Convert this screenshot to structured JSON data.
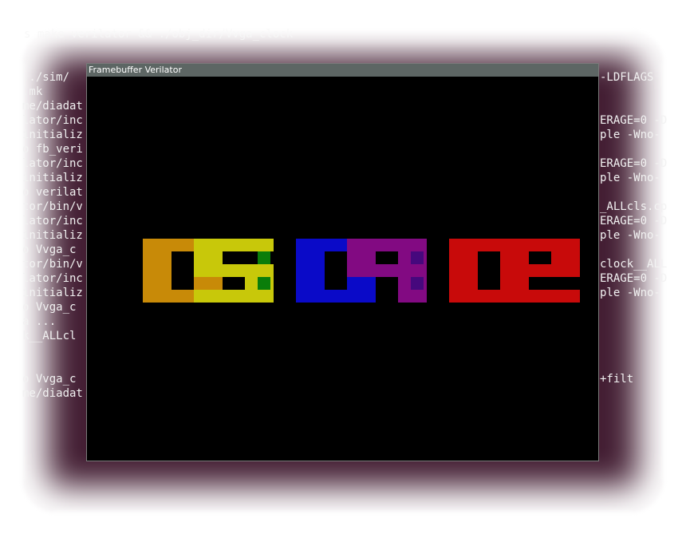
{
  "terminal": {
    "prompt_command": "s make verilator && ./obj_dir/Vvga_clock",
    "left_lines": [
      "../sim/",
      ".mk",
      "me/diadat",
      "lator/inc",
      "initializ",
      "o fb_veri",
      "lator/inc",
      "initializ",
      "o verilat",
      "tor/bin/v",
      "lator/inc",
      "initializ",
      "o Vvga_c",
      "tor/bin/v",
      "lator/inc",
      "initializ",
      "o Vvga_c",
      "a ...",
      "k__ALLcl",
      "",
      "",
      "o Vvga_c",
      "me/diadat"
    ],
    "right_lines": [
      "-LDFLAGS",
      "",
      "",
      "ERAGE=0 -D",
      "ple -Wno-",
      "",
      "ERAGE=0 -D",
      "ple -Wno-",
      "",
      "_ALLcls.cp",
      "ERAGE=0 -D",
      "ple -Wno-",
      "",
      "clock__ALL",
      "ERAGE=0 -D",
      "ple -Wno-",
      "",
      "",
      "",
      "",
      "",
      "+filt",
      ""
    ]
  },
  "window": {
    "title": "Framebuffer Verilator"
  },
  "clock": {
    "time_text": "05:09:02",
    "digits": [
      {
        "char": "0",
        "color": "#c88a08"
      },
      {
        "char": "5",
        "color": "#c8c80a"
      },
      {
        "char": "0",
        "color": "#0a0ac8"
      },
      {
        "char": "9",
        "color": "#820a82"
      },
      {
        "char": "0",
        "color": "#c80a0a"
      },
      {
        "char": "2",
        "color": "#c80a0a"
      }
    ],
    "colon_colors": [
      "#0a7d0a",
      "#46087d"
    ]
  }
}
